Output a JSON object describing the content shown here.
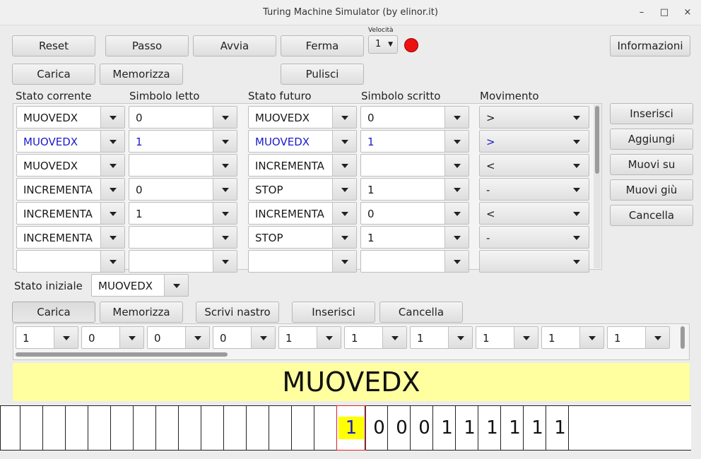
{
  "window": {
    "title": "Turing Machine Simulator (by elinor.it)",
    "minimize": "–",
    "maximize": "□",
    "close": "×"
  },
  "toolbar": {
    "reset": "Reset",
    "passo": "Passo",
    "avvia": "Avvia",
    "ferma": "Ferma",
    "velocita_label": "Velocità",
    "velocita_value": "1",
    "informazioni": "Informazioni",
    "carica": "Carica",
    "memorizza": "Memorizza",
    "pulisci": "Pulisci",
    "running_indicator_color": "#ee1111"
  },
  "rules": {
    "headers": [
      "Stato corrente",
      "Simbolo letto",
      "Stato futuro",
      "Simbolo scritto",
      "Movimento"
    ],
    "rows": [
      {
        "current": "MUOVEDX",
        "read": "0",
        "next": "MUOVEDX",
        "write": "0",
        "move": ">",
        "highlight": false
      },
      {
        "current": "MUOVEDX",
        "read": "1",
        "next": "MUOVEDX",
        "write": "1",
        "move": ">",
        "highlight": true
      },
      {
        "current": "MUOVEDX",
        "read": "",
        "next": "INCREMENTA",
        "write": "",
        "move": "<",
        "highlight": false
      },
      {
        "current": "INCREMENTA",
        "read": "0",
        "next": "STOP",
        "write": "1",
        "move": "-",
        "highlight": false
      },
      {
        "current": "INCREMENTA",
        "read": "1",
        "next": "INCREMENTA",
        "write": "0",
        "move": "<",
        "highlight": false
      },
      {
        "current": "INCREMENTA",
        "read": "",
        "next": "STOP",
        "write": "1",
        "move": "-",
        "highlight": false
      },
      {
        "current": "",
        "read": "",
        "next": "",
        "write": "",
        "move": "",
        "highlight": false
      }
    ],
    "side_buttons": [
      "Inserisci",
      "Aggiungi",
      "Muovi su",
      "Muovi giù",
      "Cancella"
    ],
    "highlight_color": "#1a1ac8"
  },
  "initial_state": {
    "label": "Stato iniziale",
    "value": "MUOVEDX"
  },
  "tape_toolbar": {
    "carica": "Carica",
    "memorizza": "Memorizza",
    "scrivi": "Scrivi nastro",
    "inserisci": "Inserisci",
    "cancella": "Cancella"
  },
  "tape_editor": [
    "1",
    "0",
    "0",
    "0",
    "1",
    "1",
    "1",
    "1",
    "1",
    "1"
  ],
  "current_state": "MUOVEDX",
  "tape": {
    "cells": [
      "",
      "",
      "",
      "",
      "",
      "",
      "",
      "",
      "",
      "",
      "",
      "",
      "",
      "",
      "",
      "1",
      "0",
      "0",
      "0",
      "1",
      "1",
      "1",
      "1",
      "1",
      "1",
      ""
    ],
    "head_index": 15
  }
}
